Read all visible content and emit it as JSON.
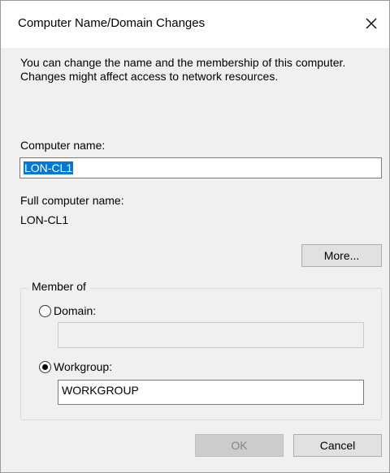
{
  "window": {
    "title": "Computer Name/Domain Changes",
    "close_icon": "close-icon"
  },
  "intro_text": "You can change the name and the membership of this computer. Changes might affect access to network resources.",
  "computer_name": {
    "label": "Computer name:",
    "value": "LON-CL1"
  },
  "full_computer_name": {
    "label": "Full computer name:",
    "value": "LON-CL1"
  },
  "more_button": "More...",
  "member_of": {
    "legend": "Member of",
    "domain": {
      "label": "Domain:",
      "selected": false,
      "value": ""
    },
    "workgroup": {
      "label": "Workgroup:",
      "selected": true,
      "value": "WORKGROUP"
    }
  },
  "buttons": {
    "ok": "OK",
    "cancel": "Cancel"
  },
  "colors": {
    "selection": "#0078d7",
    "dialog_bg": "#f0f0f0"
  }
}
